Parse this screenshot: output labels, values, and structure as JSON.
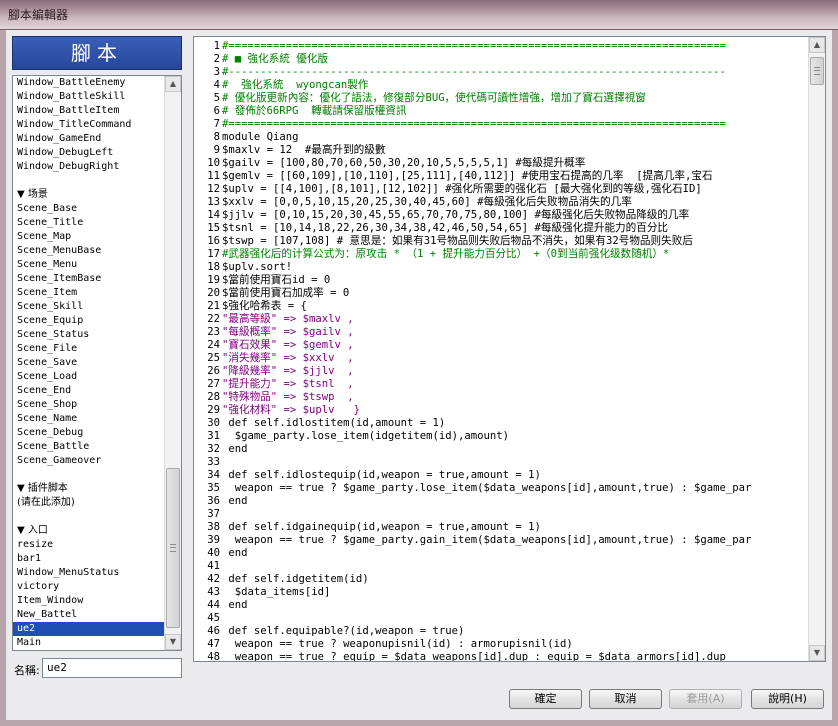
{
  "window": {
    "title": "腳本編輯器"
  },
  "header": {
    "title": "腳本"
  },
  "script_list": [
    {
      "label": "Window_BattleEnemy",
      "kind": "item"
    },
    {
      "label": "Window_BattleSkill",
      "kind": "item"
    },
    {
      "label": "Window_BattleItem",
      "kind": "item"
    },
    {
      "label": "Window_TitleCommand",
      "kind": "item"
    },
    {
      "label": "Window_GameEnd",
      "kind": "item"
    },
    {
      "label": "Window_DebugLeft",
      "kind": "item"
    },
    {
      "label": "Window_DebugRight",
      "kind": "item"
    },
    {
      "label": "",
      "kind": "spacer"
    },
    {
      "label": "▼ 场景",
      "kind": "section"
    },
    {
      "label": "Scene_Base",
      "kind": "item"
    },
    {
      "label": "Scene_Title",
      "kind": "item"
    },
    {
      "label": "Scene_Map",
      "kind": "item"
    },
    {
      "label": "Scene_MenuBase",
      "kind": "item"
    },
    {
      "label": "Scene_Menu",
      "kind": "item"
    },
    {
      "label": "Scene_ItemBase",
      "kind": "item"
    },
    {
      "label": "Scene_Item",
      "kind": "item"
    },
    {
      "label": "Scene_Skill",
      "kind": "item"
    },
    {
      "label": "Scene_Equip",
      "kind": "item"
    },
    {
      "label": "Scene_Status",
      "kind": "item"
    },
    {
      "label": "Scene_File",
      "kind": "item"
    },
    {
      "label": "Scene_Save",
      "kind": "item"
    },
    {
      "label": "Scene_Load",
      "kind": "item"
    },
    {
      "label": "Scene_End",
      "kind": "item"
    },
    {
      "label": "Scene_Shop",
      "kind": "item"
    },
    {
      "label": "Scene_Name",
      "kind": "item"
    },
    {
      "label": "Scene_Debug",
      "kind": "item"
    },
    {
      "label": "Scene_Battle",
      "kind": "item"
    },
    {
      "label": "Scene_Gameover",
      "kind": "item"
    },
    {
      "label": "",
      "kind": "spacer"
    },
    {
      "label": "▼ 插件脚本",
      "kind": "section"
    },
    {
      "label": "(请在此添加)",
      "kind": "section"
    },
    {
      "label": "",
      "kind": "spacer"
    },
    {
      "label": "▼ 入口",
      "kind": "section"
    },
    {
      "label": "resize",
      "kind": "item"
    },
    {
      "label": "bar1",
      "kind": "item"
    },
    {
      "label": "Window_MenuStatus",
      "kind": "item"
    },
    {
      "label": "victory",
      "kind": "item"
    },
    {
      "label": "Item_Window",
      "kind": "item"
    },
    {
      "label": "New_Battel",
      "kind": "item"
    },
    {
      "label": "ue2",
      "kind": "item",
      "selected": true
    },
    {
      "label": "Main",
      "kind": "item"
    }
  ],
  "name_field": {
    "label": "名稱:",
    "value": "ue2"
  },
  "code_lines": [
    {
      "n": "1",
      "t": "#==============================================================================",
      "c": "comment"
    },
    {
      "n": "2",
      "t": "# ■ 強化系統 優化版",
      "c": "comment"
    },
    {
      "n": "3",
      "t": "#------------------------------------------------------------------------------",
      "c": "comment"
    },
    {
      "n": "4",
      "t": "#  強化系統  wyongcan製作",
      "c": "comment"
    },
    {
      "n": "5",
      "t": "# 優化版更新內容：優化了語法，修復部分BUG，使代碼可讀性增強，增加了寶石選擇視窗",
      "c": "comment"
    },
    {
      "n": "6",
      "t": "# 發佈於66RPG  轉載請保留版權資訊",
      "c": "comment"
    },
    {
      "n": "7",
      "t": "#==============================================================================",
      "c": "comment"
    },
    {
      "n": "8",
      "t": "module Qiang",
      "c": "normal"
    },
    {
      "n": "9",
      "t": "$maxlv = 12  #最高升到的級數",
      "c": "normal"
    },
    {
      "n": "10",
      "t": "$gailv = [100,80,70,60,50,30,20,10,5,5,5,5,1] #每級提升概率",
      "c": "normal"
    },
    {
      "n": "11",
      "t": "$gemlv = [[60,109],[10,110],[25,111],[40,112]] #使用宝石提高的几率  [提高几率,宝石",
      "c": "normal"
    },
    {
      "n": "12",
      "t": "$uplv = [[4,100],[8,101],[12,102]] #强化所需要的强化石 [最大强化到的等级,强化石ID]",
      "c": "normal"
    },
    {
      "n": "13",
      "t": "$xxlv = [0,0,5,10,15,20,25,30,40,45,60] #每級强化后失败物品消失的几率",
      "c": "normal"
    },
    {
      "n": "14",
      "t": "$jjlv = [0,10,15,20,30,45,55,65,70,70,75,80,100] #每級强化后失败物品降级的几率",
      "c": "normal"
    },
    {
      "n": "15",
      "t": "$tsnl = [10,14,18,22,26,30,34,38,42,46,50,54,65] #每級强化提升能力的百分比",
      "c": "normal"
    },
    {
      "n": "16",
      "t": "$tswp = [107,108] # 意思是：如果有31号物品则失败后物品不消失，如果有32号物品则失败后",
      "c": "normal"
    },
    {
      "n": "17",
      "t": "#武器强化后的计算公式为：原攻击 * （1 + 提升能力百分比） +（0到当前强化级数随机）*",
      "c": "comment"
    },
    {
      "n": "18",
      "t": "$uplv.sort!",
      "c": "normal"
    },
    {
      "n": "19",
      "t": "$當前使用寶石id = 0",
      "c": "normal"
    },
    {
      "n": "20",
      "t": "$當前使用寶石加成率 = 0",
      "c": "normal"
    },
    {
      "n": "21",
      "t": "$強化哈希表 = {",
      "c": "normal"
    },
    {
      "n": "22",
      "t": "\"最高等級\" => $maxlv ,",
      "c": "string"
    },
    {
      "n": "23",
      "t": "\"每級概率\" => $gailv ,",
      "c": "string"
    },
    {
      "n": "24",
      "t": "\"寶石效果\" => $gemlv ,",
      "c": "string"
    },
    {
      "n": "25",
      "t": "\"消失幾率\" => $xxlv  ,",
      "c": "string"
    },
    {
      "n": "26",
      "t": "\"降級幾率\" => $jjlv  ,",
      "c": "string"
    },
    {
      "n": "27",
      "t": "\"提升能力\" => $tsnl  ,",
      "c": "string"
    },
    {
      "n": "28",
      "t": "\"特殊物品\" => $tswp  ,",
      "c": "string"
    },
    {
      "n": "29",
      "t": "\"強化材料\" => $uplv   }",
      "c": "string"
    },
    {
      "n": "30",
      "t": " def self.idlostitem(id,amount = 1)",
      "c": "normal"
    },
    {
      "n": "31",
      "t": "  $game_party.lose_item(idgetitem(id),amount)",
      "c": "normal"
    },
    {
      "n": "32",
      "t": " end",
      "c": "normal"
    },
    {
      "n": "33",
      "t": "",
      "c": "normal"
    },
    {
      "n": "34",
      "t": " def self.idlostequip(id,weapon = true,amount = 1)",
      "c": "normal"
    },
    {
      "n": "35",
      "t": "  weapon == true ? $game_party.lose_item($data_weapons[id],amount,true) : $game_par",
      "c": "normal"
    },
    {
      "n": "36",
      "t": " end",
      "c": "normal"
    },
    {
      "n": "37",
      "t": "",
      "c": "normal"
    },
    {
      "n": "38",
      "t": " def self.idgainequip(id,weapon = true,amount = 1)",
      "c": "normal"
    },
    {
      "n": "39",
      "t": "  weapon == true ? $game_party.gain_item($data_weapons[id],amount,true) : $game_par",
      "c": "normal"
    },
    {
      "n": "40",
      "t": " end",
      "c": "normal"
    },
    {
      "n": "41",
      "t": "",
      "c": "normal"
    },
    {
      "n": "42",
      "t": " def self.idgetitem(id)",
      "c": "normal"
    },
    {
      "n": "43",
      "t": "  $data_items[id]",
      "c": "normal"
    },
    {
      "n": "44",
      "t": " end",
      "c": "normal"
    },
    {
      "n": "45",
      "t": "",
      "c": "normal"
    },
    {
      "n": "46",
      "t": " def self.equipable?(id,weapon = true)",
      "c": "normal"
    },
    {
      "n": "47",
      "t": "  weapon == true ? weaponupisnil(id) : armorupisnil(id)",
      "c": "normal"
    },
    {
      "n": "48",
      "t": "  weapon == true ? equip = $data_weapons[id].dup : equip = $data_armors[id].dup",
      "c": "normal"
    }
  ],
  "buttons": {
    "ok": "確定",
    "cancel": "取消",
    "apply": "套用(A)",
    "help": "說明(H)"
  }
}
